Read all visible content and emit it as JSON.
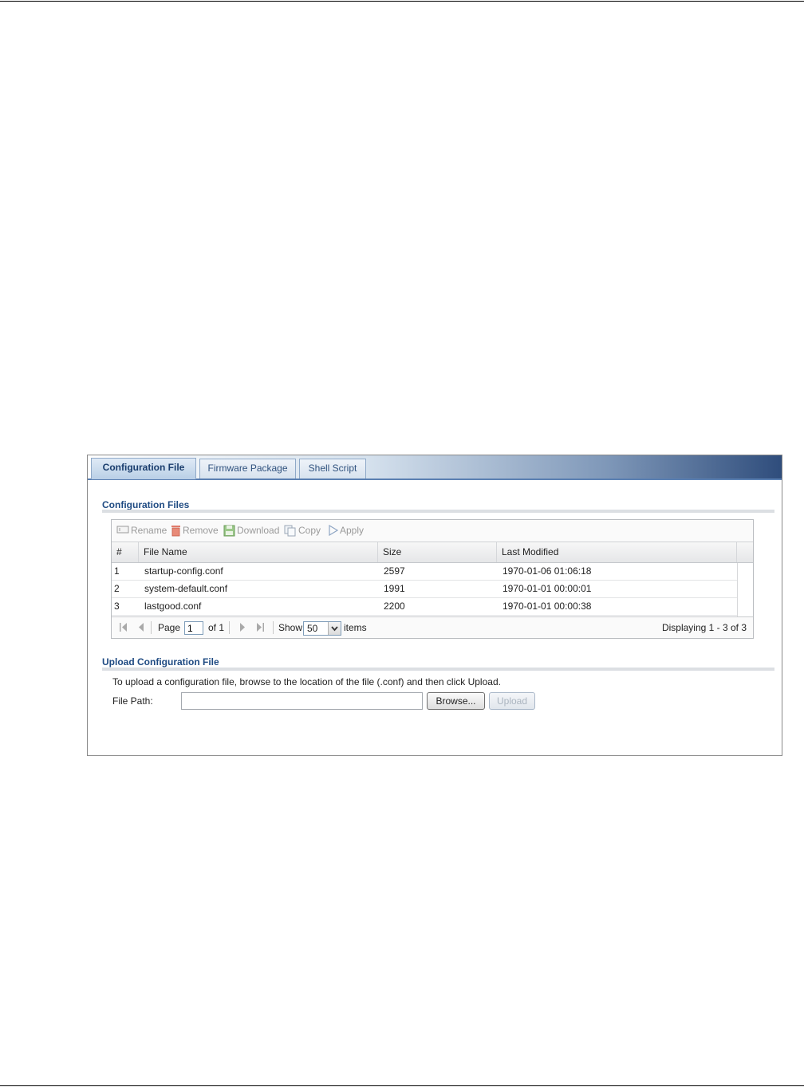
{
  "tabs": [
    {
      "label": "Configuration File",
      "active": true
    },
    {
      "label": "Firmware Package",
      "active": false
    },
    {
      "label": "Shell Script",
      "active": false
    }
  ],
  "config_section": {
    "title": "Configuration Files",
    "toolbar": {
      "rename": "Rename",
      "remove": "Remove",
      "download": "Download",
      "copy": "Copy",
      "apply": "Apply"
    },
    "columns": [
      "#",
      "File Name",
      "Size",
      "Last Modified"
    ],
    "rows": [
      {
        "index": "1",
        "name": "startup-config.conf",
        "size": "2597",
        "modified": "1970-01-06 01:06:18"
      },
      {
        "index": "2",
        "name": "system-default.conf",
        "size": "1991",
        "modified": "1970-01-01 00:00:01"
      },
      {
        "index": "3",
        "name": "lastgood.conf",
        "size": "2200",
        "modified": "1970-01-01 00:00:38"
      }
    ],
    "pager": {
      "page_label": "Page",
      "page_value": "1",
      "of_label": "of 1",
      "show_label": "Show",
      "show_value": "50",
      "items_label": "items",
      "displaying": "Displaying 1 - 3 of 3"
    }
  },
  "upload_section": {
    "title": "Upload Configuration File",
    "instructions": "To upload a configuration file, browse to the location of the file (.conf) and then click Upload.",
    "file_path_label": "File Path:",
    "file_path_value": "",
    "browse_label": "Browse...",
    "upload_label": "Upload"
  },
  "colors": {
    "accent": "#1e4a82",
    "tab_border": "#5b80b2",
    "disabled_text": "#9a9a9a"
  }
}
